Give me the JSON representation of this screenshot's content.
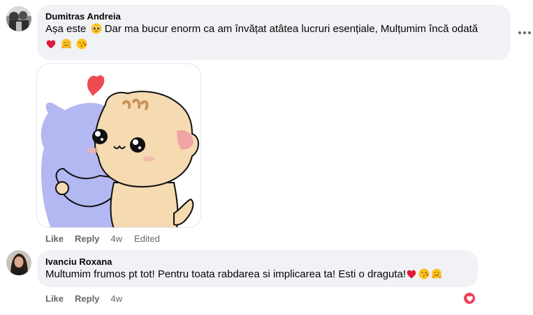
{
  "comments": [
    {
      "author": "Dumitras Andreia",
      "text_part1": "Așa este",
      "text_part2": "Dar ma bucur enorm ca am învățat atâtea lucruri esențiale, Mulțumim încă odată",
      "emojis_inline": [
        "pleading-face-emoji"
      ],
      "emojis_trailing": [
        "red-heart-emoji",
        "hugging-face-emoji",
        "face-blowing-kiss-emoji"
      ],
      "sticker": "hugging-cats-sticker",
      "actions": {
        "like": "Like",
        "reply": "Reply",
        "time": "4w",
        "edited": "Edited"
      }
    },
    {
      "author": "Ivanciu Roxana",
      "text": "Multumim frumos pt tot! Pentru toata rabdarea si implicarea ta! Esti o draguta!",
      "emojis_trailing": [
        "red-heart-emoji",
        "face-blowing-kiss-emoji",
        "hugging-face-emoji"
      ],
      "actions": {
        "like": "Like",
        "reply": "Reply",
        "time": "4w"
      },
      "reaction": "love-reaction"
    }
  ],
  "colors": {
    "bubble": "#f0f2f5",
    "meta_text": "#65676b",
    "love_reaction": "#f33e58"
  }
}
